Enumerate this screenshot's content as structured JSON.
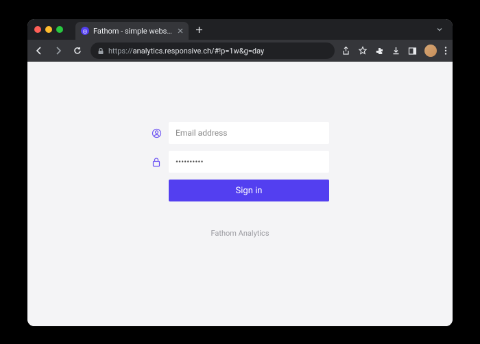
{
  "window": {
    "tab_title": "Fathom - simple website analy",
    "url_scheme": "https://",
    "url_rest": "analytics.responsive.ch/#!p=1w&g=day"
  },
  "form": {
    "email_placeholder": "Email address",
    "password_value": "**********",
    "signin_label": "Sign in"
  },
  "footer": {
    "text": "Fathom Analytics"
  }
}
